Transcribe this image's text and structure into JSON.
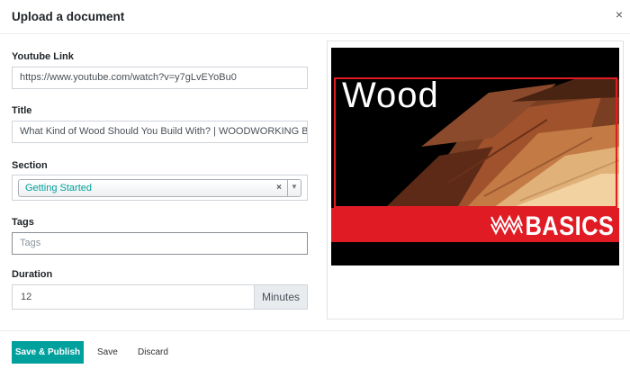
{
  "modal": {
    "title": "Upload a document",
    "close_label": "×"
  },
  "form": {
    "youtube": {
      "label": "Youtube Link",
      "value": "https://www.youtube.com/watch?v=y7gLvEYoBu0"
    },
    "title": {
      "label": "Title",
      "value": "What Kind of Wood Should You Build With? | WOODWORKING BASICS"
    },
    "section": {
      "label": "Section",
      "value": "Getting Started",
      "clear": "×",
      "arrow": "▼"
    },
    "tags": {
      "label": "Tags",
      "placeholder": "Tags"
    },
    "duration": {
      "label": "Duration",
      "value": "12",
      "unit": "Minutes"
    }
  },
  "preview": {
    "headline": "Wood",
    "banner_text": "BASICS"
  },
  "footer": {
    "save_publish": "Save & Publish",
    "save": "Save",
    "discard": "Discard"
  },
  "colors": {
    "accent": "#00a09d",
    "banner_red": "#e01b24"
  }
}
